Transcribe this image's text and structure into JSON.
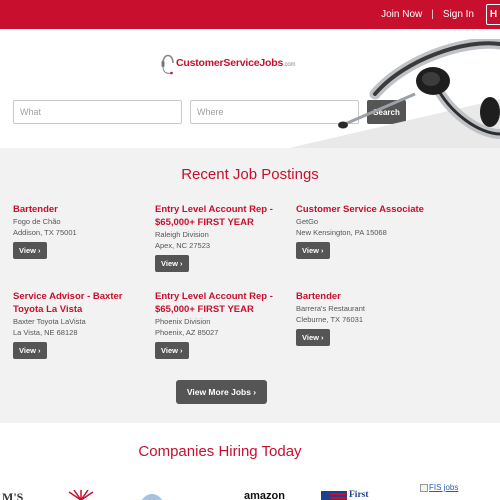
{
  "topbar": {
    "join_label": "Join Now",
    "separator": "|",
    "signin_label": "Sign In",
    "hire_label": "H"
  },
  "logo": {
    "name": "CustomerServiceJobs",
    "suffix": ".com",
    "icon": "headset-icon"
  },
  "search": {
    "what_placeholder": "What",
    "where_placeholder": "Where",
    "button_label": "Search"
  },
  "recent": {
    "title": "Recent Job Postings",
    "view_label": "View ›",
    "jobs": [
      {
        "title": "Bartender",
        "company": "Fogo de Chão",
        "location": "Addison, TX 75001"
      },
      {
        "title": "Entry Level Account Rep - $65,000+ FIRST YEAR",
        "company": "Raleigh Division",
        "location": "Apex, NC 27523"
      },
      {
        "title": "Customer Service Associate",
        "company": "GetGo",
        "location": "New Kensington, PA 15068"
      },
      {
        "title": "Service Advisor - Baxter Toyota La Vista",
        "company": "Baxter Toyota LaVista",
        "location": "La Vista, NE 68128"
      },
      {
        "title": "Entry Level Account Rep - $65,000+ FIRST YEAR",
        "company": "Phoenix Division",
        "location": "Phoenix, AZ 85027"
      },
      {
        "title": "Bartender",
        "company": "Barrera's Restaurant",
        "location": "Cleburne, TX 76031"
      }
    ],
    "more_label": "View More Jobs ›"
  },
  "companies": {
    "title": "Companies Hiring Today",
    "fis_alt": "FIS jobs",
    "partial_logos": [
      "M'S",
      "amazon",
      "First"
    ]
  },
  "colors": {
    "brand_red": "#c8102e",
    "button_gray": "#555555",
    "section_gray": "#f2f2f2"
  }
}
